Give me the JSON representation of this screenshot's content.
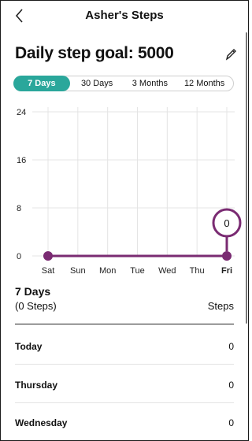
{
  "header": {
    "title": "Asher's Steps"
  },
  "goal": {
    "label": "Daily step goal: 5000"
  },
  "tabs": [
    {
      "label": "7 Days",
      "active": true
    },
    {
      "label": "30 Days",
      "active": false
    },
    {
      "label": "3 Months",
      "active": false
    },
    {
      "label": "12 Months",
      "active": false
    }
  ],
  "colors": {
    "accent": "#2aa79b",
    "series": "#7a2b72"
  },
  "chart_data": {
    "type": "line",
    "categories": [
      "Sat",
      "Sun",
      "Mon",
      "Tue",
      "Wed",
      "Thu",
      "Fri"
    ],
    "values": [
      0,
      0,
      0,
      0,
      0,
      0,
      0
    ],
    "highlight_category": "Fri",
    "highlight_label": "0",
    "ylim": [
      0,
      24
    ],
    "yticks": [
      0,
      8,
      16,
      24
    ],
    "grid": true
  },
  "summary": {
    "period": "7 Days",
    "total": "(0 Steps)",
    "unit": "Steps"
  },
  "rows": [
    {
      "day": "Today",
      "value": "0"
    },
    {
      "day": "Thursday",
      "value": "0"
    },
    {
      "day": "Wednesday",
      "value": "0"
    }
  ]
}
